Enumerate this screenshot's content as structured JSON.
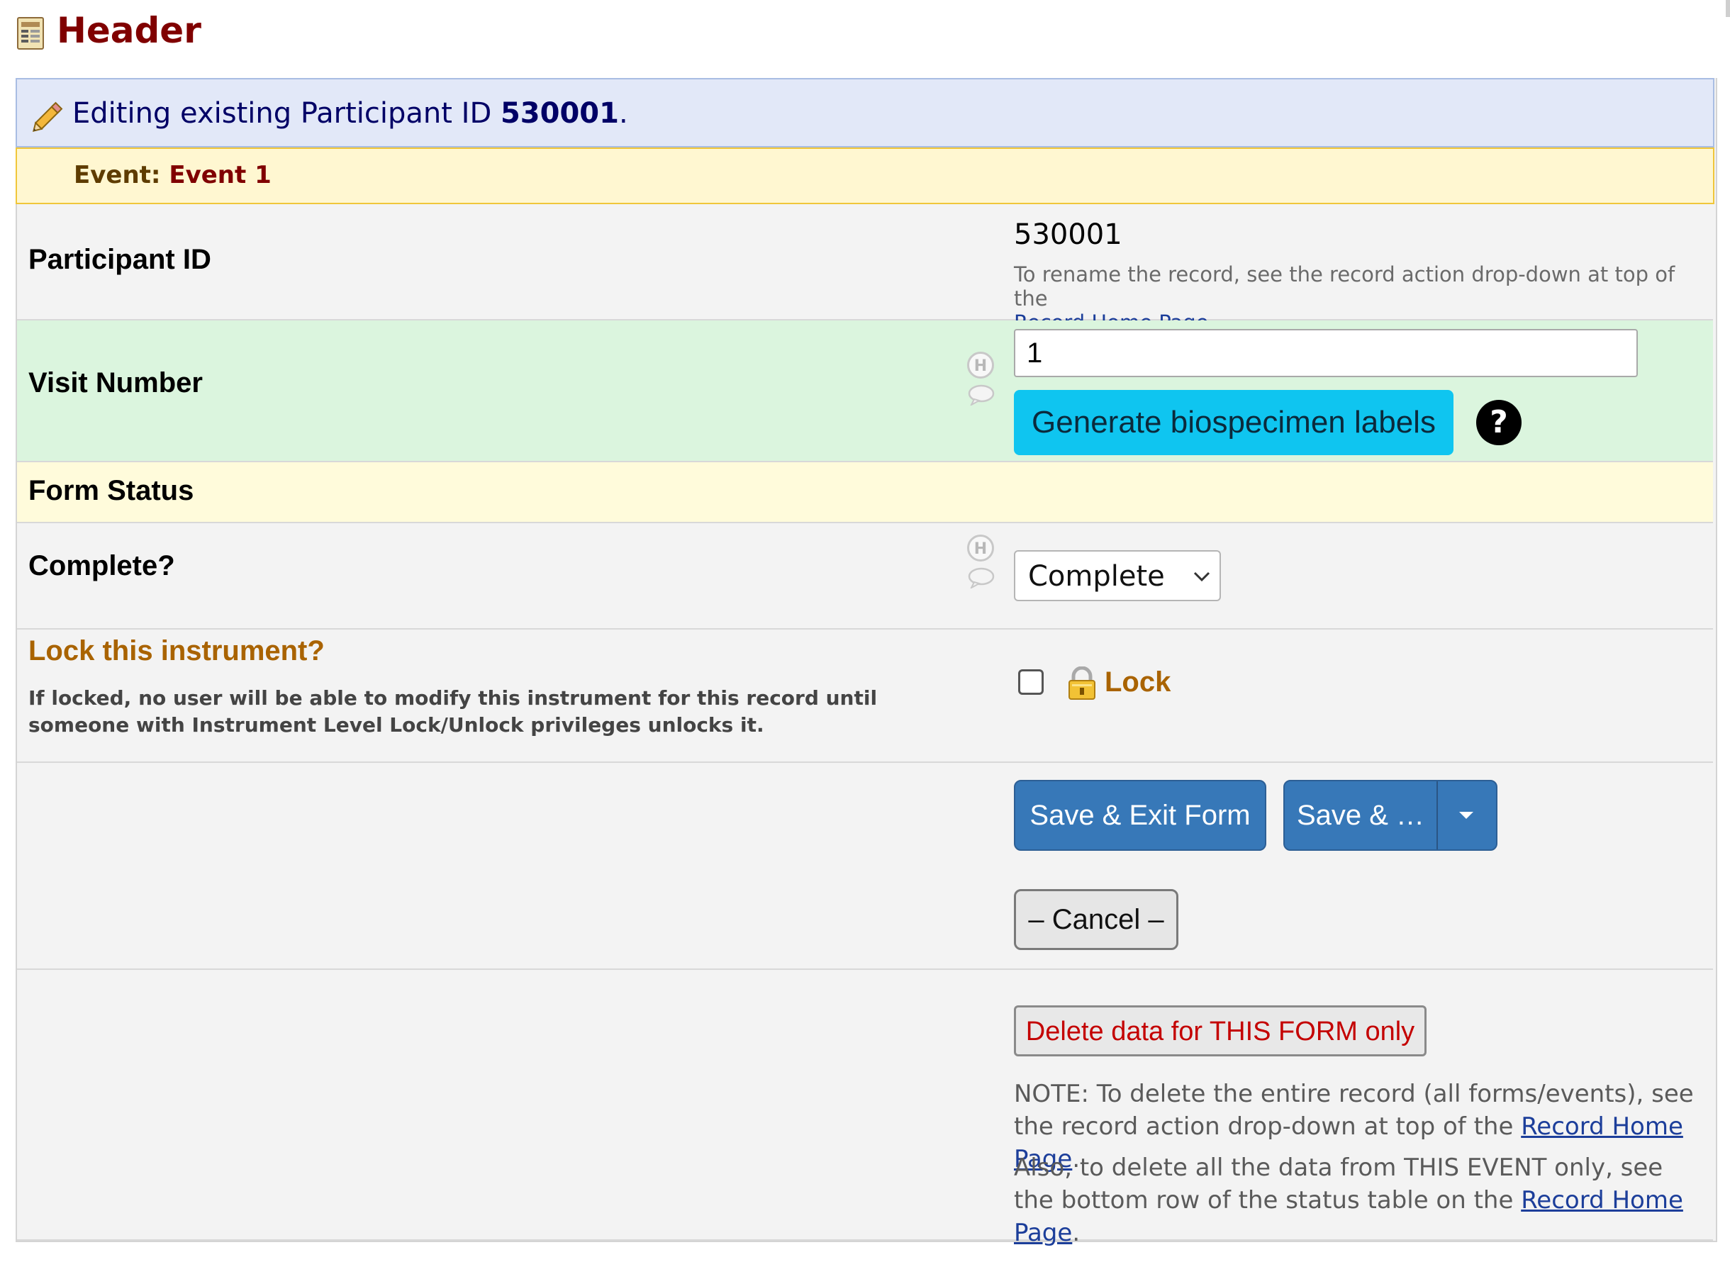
{
  "header": {
    "title": "Header",
    "icon": "form-icon"
  },
  "banner": {
    "editing_prefix": "Editing existing Participant ID",
    "record_id": "530001",
    "editing_suffix": ".",
    "event_label": "Event:",
    "event_name": "Event 1"
  },
  "fields": {
    "participant_id": {
      "label": "Participant ID",
      "value": "530001",
      "note_prefix": "To rename the record, see the record action drop-down at top of the",
      "note_link": "Record Home Page",
      "note_suffix": "."
    },
    "visit_number": {
      "label": "Visit Number",
      "value": "1",
      "generate_button": "Generate biospecimen labels",
      "help_icon": "?"
    },
    "form_status": {
      "section_label": "Form Status"
    },
    "complete": {
      "label": "Complete?",
      "selected": "Complete"
    },
    "lock": {
      "label": "Lock this instrument?",
      "description": "If locked, no user will be able to modify this instrument for this record until someone with Instrument Level Lock/Unlock privileges unlocks it.",
      "checkbox_label": "Lock",
      "checked": false
    }
  },
  "actions": {
    "save_exit": "Save & Exit Form",
    "save_more": "Save & …",
    "cancel": "– Cancel –",
    "delete_form": "Delete data for THIS FORM only",
    "note1_prefix": "NOTE: To delete the entire record (all forms/events), see the record action drop-down at top of the",
    "note1_link": "Record Home Page",
    "note1_suffix": ".",
    "note2_prefix": "Also, to delete all the data from THIS EVENT only, see the bottom row of the status table on the",
    "note2_link": "Record Home Page",
    "note2_suffix": "."
  },
  "icons": {
    "hint": "H",
    "comment": "comment-bubble-icon",
    "lock": "padlock-icon",
    "pencil": "pencil-icon"
  },
  "colors": {
    "header_title": "#800000",
    "edit_banner_bg": "#e2e8f8",
    "event_banner_bg": "#fff7d1",
    "visit_row_bg": "#dbf5de",
    "form_status_bg": "#fffbdb",
    "generate_button": "#0fc5f0",
    "save_button": "#3778b8",
    "delete_text": "#c40000",
    "lock_label": "#a96300"
  }
}
